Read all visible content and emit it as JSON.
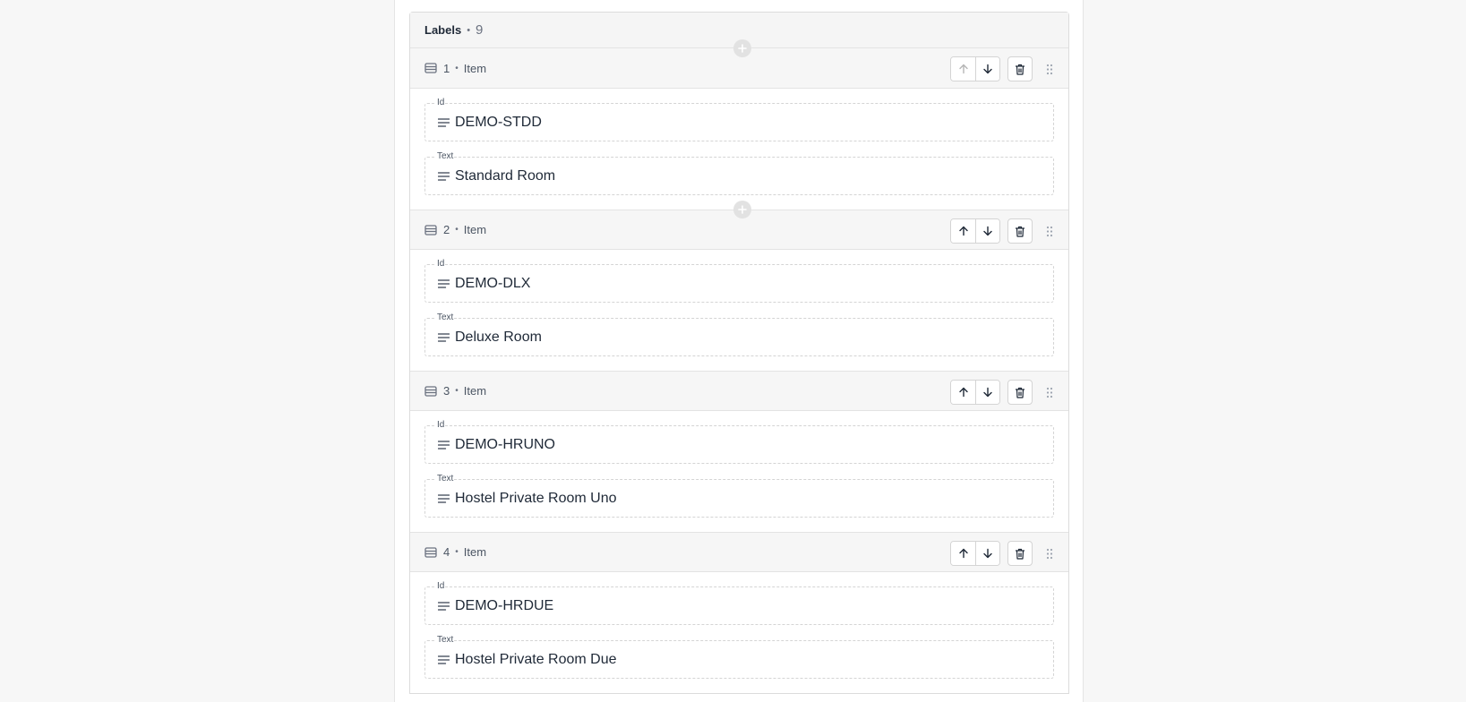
{
  "list": {
    "title": "Labels",
    "separator": "•",
    "count": "9"
  },
  "items": [
    {
      "index": "1",
      "kind": "Item",
      "id_label": "Id",
      "id_value": "DEMO-STDD",
      "text_label": "Text",
      "text_value": "Standard Room",
      "move_up_disabled": true
    },
    {
      "index": "2",
      "kind": "Item",
      "id_label": "Id",
      "id_value": "DEMO-DLX",
      "text_label": "Text",
      "text_value": "Deluxe Room",
      "move_up_disabled": false
    },
    {
      "index": "3",
      "kind": "Item",
      "id_label": "Id",
      "id_value": "DEMO-HRUNO",
      "text_label": "Text",
      "text_value": "Hostel Private Room Uno",
      "move_up_disabled": false
    },
    {
      "index": "4",
      "kind": "Item",
      "id_label": "Id",
      "id_value": "DEMO-HRDUE",
      "text_label": "Text",
      "text_value": "Hostel Private Room Due",
      "move_up_disabled": false
    }
  ],
  "item_separator": "•",
  "icons": {
    "item": "list-item-icon",
    "field": "text-lines-icon",
    "move_up": "arrow-up-icon",
    "move_down": "arrow-down-icon",
    "delete": "trash-icon",
    "drag": "drag-handle-icon",
    "add": "plus-circle-icon"
  },
  "colors": {
    "page_bg": "#f7f7f7",
    "panel_bg": "#ffffff",
    "header_bg": "#f6f6f6",
    "border": "#d4d4d4",
    "text": "#1f2937",
    "muted": "#6b7280"
  }
}
